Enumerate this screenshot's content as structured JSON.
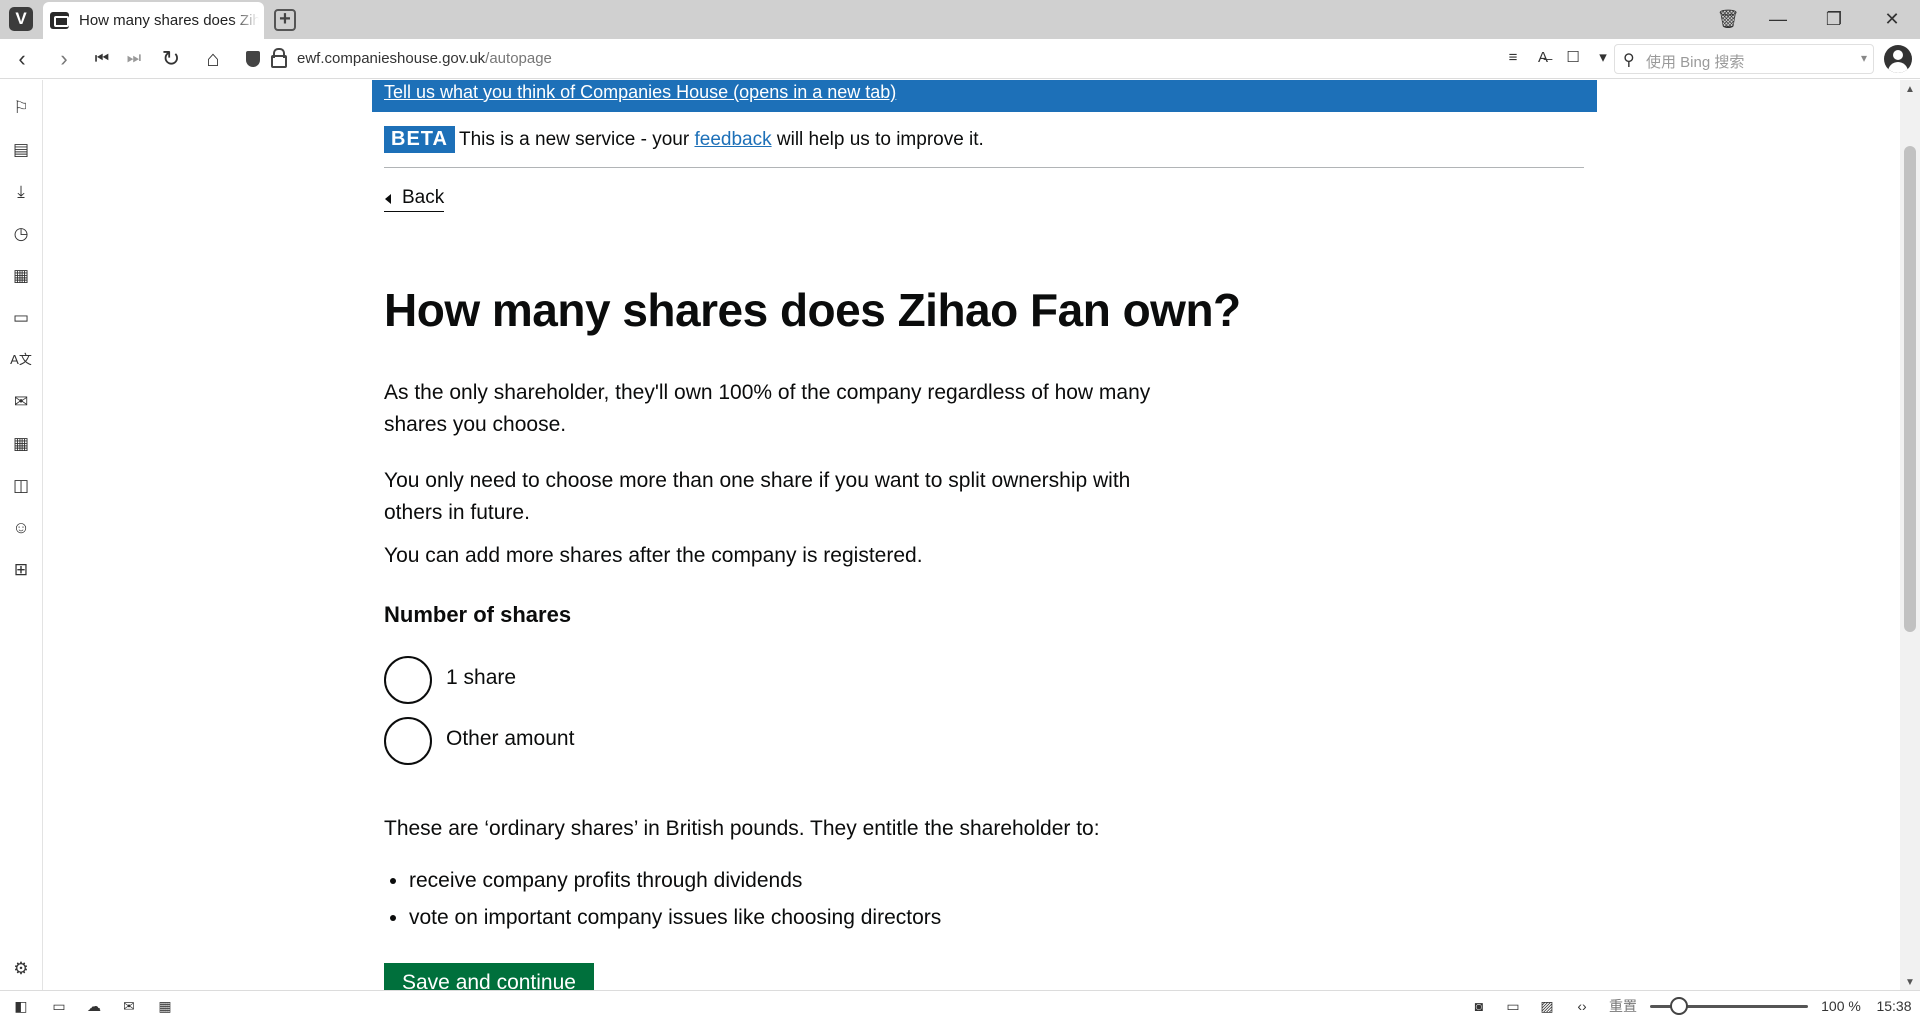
{
  "browser": {
    "tab_title": "How many shares does Zihao Fan own?",
    "new_tab_icon": "+",
    "url_domain": "ewf.companieshouse.gov.uk",
    "url_path": "/autopage",
    "search_placeholder": "使用 Bing 搜索",
    "zoom_reset_label": "重置",
    "zoom_level": "100 %",
    "clock": "15:38"
  },
  "page": {
    "feedback_banner_link": "Tell us what you think of Companies House (opens in a new tab)",
    "beta_tag": "BETA",
    "beta_text_before": "This is a new service - your ",
    "beta_feedback_link": "feedback",
    "beta_text_after": " will help us to improve it.",
    "back_link": "Back",
    "title": "How many shares does Zihao Fan own?",
    "paragraphs": [
      "As the only shareholder, they'll own 100% of the company regardless of how many shares you choose.",
      "You only need to choose more than one share if you want to split ownership with others in future.",
      "You can add more shares after the company is registered."
    ],
    "field_label": "Number of shares",
    "options": [
      {
        "label": "1 share",
        "selected": false
      },
      {
        "label": "Other amount",
        "selected": false
      }
    ],
    "shares_note": "These are ‘ordinary shares’ in British pounds. They entitle the shareholder to:",
    "rights": [
      "receive company profits through dividends",
      "vote on important company issues like choosing directors"
    ],
    "save_button": "Save and continue"
  },
  "colors": {
    "govuk_blue": "#1d70b8",
    "govuk_green": "#00703c",
    "text": "#0b0c0c"
  }
}
